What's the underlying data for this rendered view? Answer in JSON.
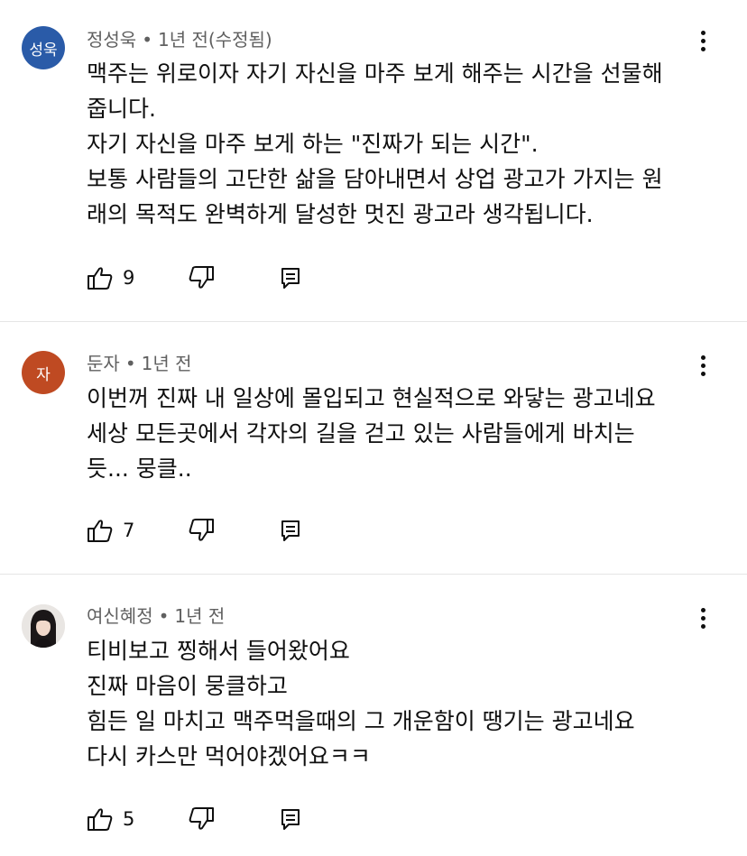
{
  "comments": [
    {
      "avatar_text": "성욱",
      "avatar_color": "#2a5ba8",
      "author": "정성욱",
      "separator": "•",
      "time": "1년 전(수정됨)",
      "lines": [
        "맥주는 위로이자 자기 자신을 마주 보게 해주는 시간을 선물해",
        "줍니다.",
        "자기 자신을 마주 보게 하는 \"진짜가 되는 시간\".",
        "보통 사람들의 고단한 삶을 담아내면서 상업 광고가 가지는 원",
        "래의 목적도 완벽하게 달성한 멋진 광고라 생각됩니다."
      ],
      "likes": "9"
    },
    {
      "avatar_text": "자",
      "avatar_color": "#bf4a22",
      "author": "둔자",
      "separator": "•",
      "time": "1년 전",
      "lines": [
        "이번꺼 진짜 내 일상에 몰입되고 현실적으로 와닿는 광고네요",
        "세상 모든곳에서 각자의 길을 걷고 있는 사람들에게 바치는",
        "듯...  뭉클.."
      ],
      "likes": "7"
    },
    {
      "avatar_text": "",
      "avatar_color": "#e9e6e3",
      "author": "여신혜정",
      "separator": "•",
      "time": "1년 전",
      "lines": [
        "티비보고 찡해서 들어왔어요",
        "진짜 마음이 뭉클하고",
        "힘든 일 마치고 맥주먹을때의 그 개운함이 땡기는 광고네요",
        "다시 카스만 먹어야겠어요ㅋㅋ"
      ],
      "likes": "5"
    }
  ],
  "icons": {
    "like": "thumb-up-icon",
    "dislike": "thumb-down-icon",
    "reply": "reply-icon",
    "menu": "more-vert-icon"
  }
}
